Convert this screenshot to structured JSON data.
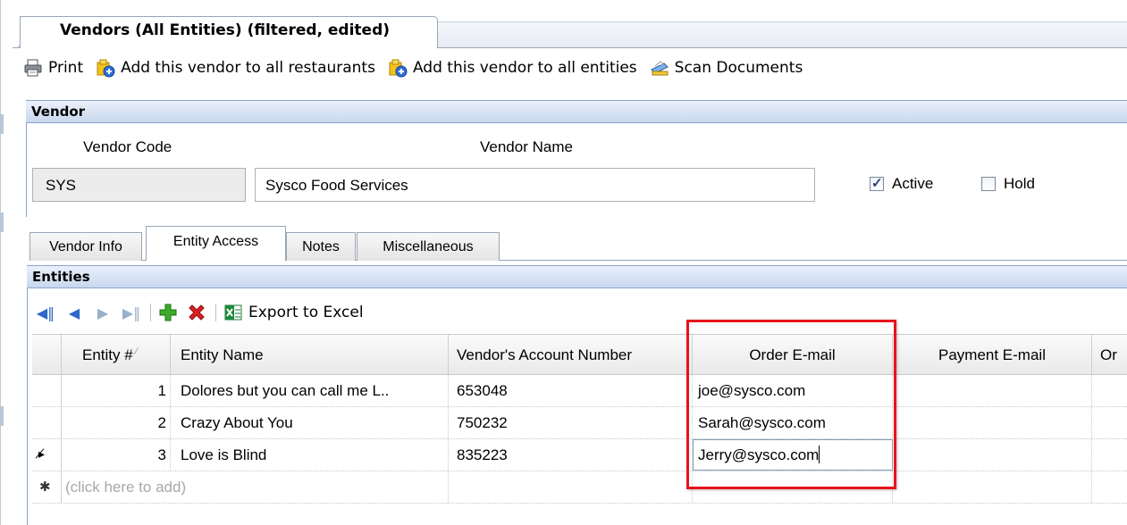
{
  "document_tab": {
    "title": "Vendors (All Entities) (filtered, edited)"
  },
  "toolbar": {
    "print": "Print",
    "add_restaurants": "Add this vendor to all restaurants",
    "add_entities": "Add this vendor to all entities",
    "scan": "Scan Documents"
  },
  "vendor": {
    "section_title": "Vendor",
    "code_label": "Vendor Code",
    "name_label": "Vendor Name",
    "code_value": "SYS",
    "name_value": "Sysco Food Services",
    "active_label": "Active",
    "active_checked": true,
    "hold_label": "Hold",
    "hold_checked": false
  },
  "tabs": [
    {
      "label": "Vendor Info",
      "active": false
    },
    {
      "label": "Entity Access",
      "active": true
    },
    {
      "label": "Notes",
      "active": false
    },
    {
      "label": "Miscellaneous",
      "active": false
    }
  ],
  "entities": {
    "section_title": "Entities",
    "export_label": "Export to Excel",
    "columns": [
      "Entity #",
      "Entity Name",
      "Vendor's Account Number",
      "Order E-mail",
      "Payment E-mail",
      "Or"
    ],
    "rows": [
      {
        "num": "1",
        "name": "Dolores but you can call me L..",
        "account": "653048",
        "order_email": "joe@sysco.com",
        "payment_email": ""
      },
      {
        "num": "2",
        "name": "Crazy About You",
        "account": "750232",
        "order_email": "Sarah@sysco.com",
        "payment_email": ""
      },
      {
        "num": "3",
        "name": "Love is Blind",
        "account": "835223",
        "order_email": "Jerry@sysco.com",
        "payment_email": ""
      }
    ],
    "add_placeholder": "(click here to add)",
    "edit_indicator": "▸̸",
    "new_row_indicator": "✱"
  },
  "colors": {
    "accent": "#c8d8ee",
    "highlight": "#e8141c",
    "nav_blue": "#2e68c8"
  }
}
